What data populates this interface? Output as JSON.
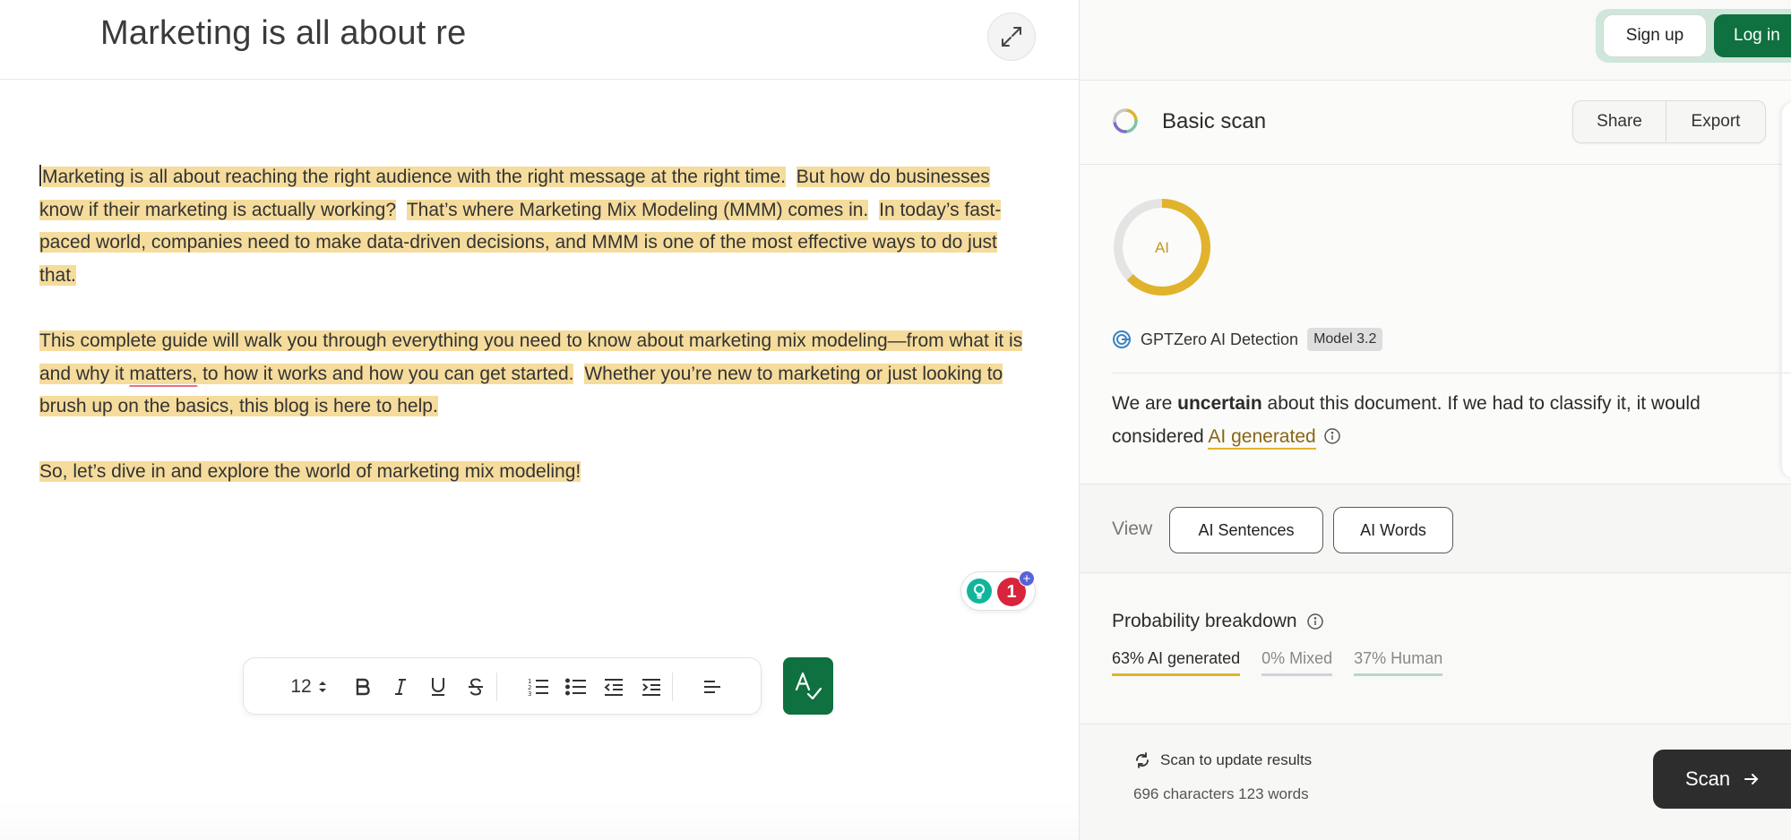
{
  "editor": {
    "title": "Marketing is all about re",
    "paragraphs": [
      [
        {
          "text": "Marketing is all about reaching the right audience with the right message at the right time.",
          "hl": true
        },
        {
          "text": " ",
          "hl": false
        },
        {
          "text": "But how do businesses know if their marketing is actually working?",
          "hl": true
        },
        {
          "text": " ",
          "hl": false
        },
        {
          "text": "That’s where Marketing Mix Modeling (MMM) comes in.",
          "hl": true
        },
        {
          "text": " ",
          "hl": false
        },
        {
          "text": "In today’s fast-paced world, companies need to make data-driven decisions, and MMM is one of the most effective ways to do just that.",
          "hl": true
        }
      ],
      [
        {
          "text": "This complete guide will walk you through everything you need to know about marketing mix modeling—from what it is and why it ",
          "hl": true
        },
        {
          "text": "matters,",
          "hl": true,
          "misspell": true
        },
        {
          "text": " to how it works and how you can get started.",
          "hl": true
        },
        {
          "text": " ",
          "hl": false
        },
        {
          "text": "Whether you’re new to marketing or just looking to brush up on the basics, this blog is here to help.",
          "hl": true
        }
      ],
      [
        {
          "text": "So, let’s dive in and explore the world of marketing mix modeling!",
          "hl": true
        }
      ]
    ],
    "grammar_count": "1",
    "grammar_plus": "+"
  },
  "toolbar": {
    "font_size": "12",
    "icons": [
      "font-size-stepper-icon",
      "bold-icon",
      "italic-icon",
      "underline-icon",
      "strikethrough-icon",
      "numbered-list-icon",
      "bullet-list-icon",
      "outdent-icon",
      "indent-icon",
      "align-left-icon",
      "spellcheck-icon"
    ]
  },
  "auth": {
    "signup_label": "Sign up",
    "login_label": "Log in"
  },
  "scan": {
    "title": "Basic scan",
    "share_label": "Share",
    "export_label": "Export",
    "donut_label": "AI",
    "ai_fraction": 0.63,
    "detector_label": "GPTZero AI Detection",
    "model_label": "Model 3.2",
    "verdict_pre": "We are ",
    "verdict_bold": "uncertain",
    "verdict_mid": " about this document. If we had to classify it, it would",
    "verdict_line2": "considered ",
    "verdict_link": "AI generated",
    "view_label": "View",
    "view_sentences": "AI Sentences",
    "view_words": "AI Words",
    "prob_title": "Probability breakdown",
    "prob_ai": "63% AI generated",
    "prob_mixed": "0% Mixed",
    "prob_human": "37% Human",
    "update_label": "Scan to update results",
    "counts": "696 characters 123 words",
    "scan_button": "Scan",
    "colors": {
      "ai": "#e1b32c",
      "brand_green": "#0f7040",
      "mixed": "#cfd3dd",
      "human": "#b9d6cb"
    }
  }
}
